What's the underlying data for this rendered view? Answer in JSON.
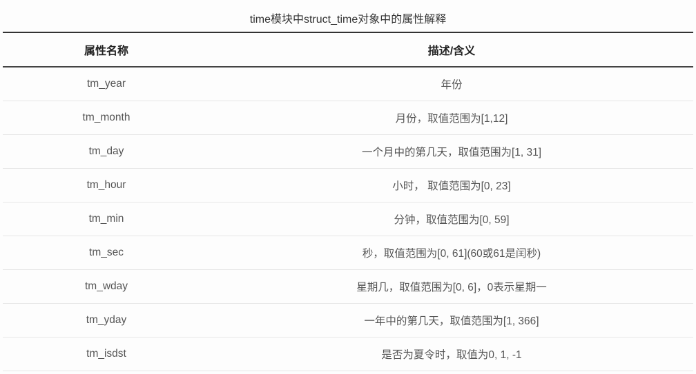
{
  "caption": "time模块中struct_time对象中的属性解释",
  "headers": {
    "name": "属性名称",
    "desc": "描述/含义"
  },
  "rows": [
    {
      "name": "tm_year",
      "desc": "年份"
    },
    {
      "name": "tm_month",
      "desc": "月份，取值范围为[1,12]"
    },
    {
      "name": "tm_day",
      "desc": "一个月中的第几天，取值范围为[1, 31]"
    },
    {
      "name": "tm_hour",
      "desc": "小时， 取值范围为[0, 23]"
    },
    {
      "name": "tm_min",
      "desc": "分钟，取值范围为[0, 59]"
    },
    {
      "name": "tm_sec",
      "desc": "秒，取值范围为[0, 61](60或61是闰秒)"
    },
    {
      "name": "tm_wday",
      "desc": "星期几，取值范围为[0, 6]，0表示星期一"
    },
    {
      "name": "tm_yday",
      "desc": "一年中的第几天，取值范围为[1, 366]"
    },
    {
      "name": "tm_isdst",
      "desc": "是否为夏令时，取值为0, 1, -1"
    }
  ]
}
